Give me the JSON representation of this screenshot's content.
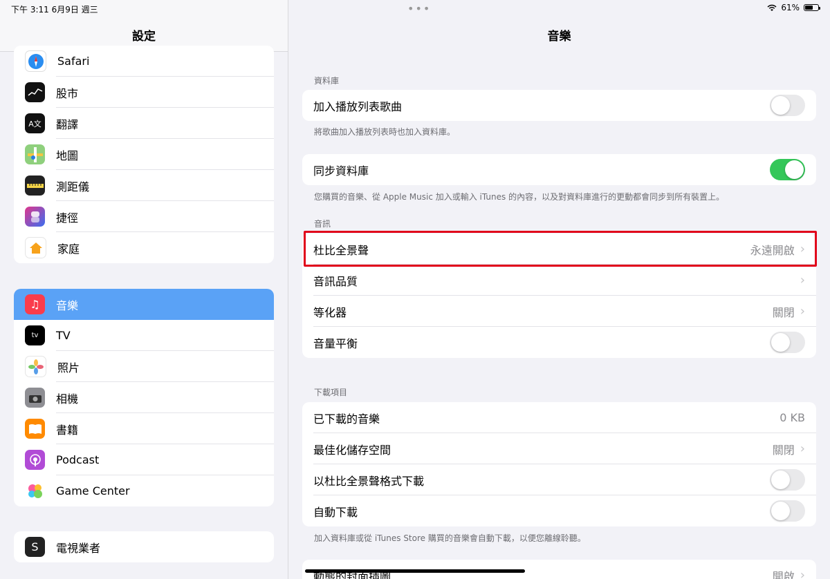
{
  "status": {
    "time_date": "下午 3:11   6月9日 週三",
    "battery": "61%",
    "battery_level": 0.61
  },
  "sidebar": {
    "title": "設定",
    "group1": [
      {
        "label": "Safari",
        "icon": "safari-icon",
        "color": "#1e88e5"
      },
      {
        "label": "股市",
        "icon": "stocks-icon",
        "color": "#111111"
      },
      {
        "label": "翻譯",
        "icon": "translate-icon",
        "color": "#111111"
      },
      {
        "label": "地圖",
        "icon": "maps-icon",
        "color": "#7cc36b"
      },
      {
        "label": "測距儀",
        "icon": "measure-icon",
        "color": "#222222"
      },
      {
        "label": "捷徑",
        "icon": "shortcuts-icon",
        "color": "#6a4cd8"
      },
      {
        "label": "家庭",
        "icon": "home-icon",
        "color": "#ffffff"
      }
    ],
    "group2": [
      {
        "label": "音樂",
        "icon": "music-icon",
        "color": "#fa3c4c"
      },
      {
        "label": "TV",
        "icon": "tv-icon",
        "color": "#000000"
      },
      {
        "label": "照片",
        "icon": "photos-icon",
        "color": "#ffffff"
      },
      {
        "label": "相機",
        "icon": "camera-icon",
        "color": "#8e8e93"
      },
      {
        "label": "書籍",
        "icon": "books-icon",
        "color": "#ff8a00"
      },
      {
        "label": "Podcast",
        "icon": "podcast-icon",
        "color": "#b14bd6"
      },
      {
        "label": "Game Center",
        "icon": "game-center-icon",
        "color": "#ffffff"
      }
    ],
    "group3": [
      {
        "label": "電視業者",
        "icon": "tv-provider-icon",
        "color": "#222222"
      }
    ]
  },
  "main": {
    "title": "音樂",
    "library": {
      "label": "資料庫",
      "add_playlist": "加入播放列表歌曲",
      "add_playlist_on": false,
      "add_playlist_foot": "將歌曲加入播放列表時也加入資料庫。",
      "sync": "同步資料庫",
      "sync_on": true,
      "sync_foot": "您購買的音樂、從 Apple Music 加入或輸入 iTunes 的內容，以及對資料庫進行的更動都會同步到所有裝置上。"
    },
    "audio": {
      "label": "音訊",
      "dolby": "杜比全景聲",
      "dolby_value": "永遠開啟",
      "quality": "音訊品質",
      "eq": "等化器",
      "eq_value": "關閉",
      "volume": "音量平衡",
      "volume_on": false
    },
    "downloads": {
      "label": "下載項目",
      "downloaded": "已下載的音樂",
      "downloaded_value": "0 KB",
      "optimize": "最佳化儲存空間",
      "optimize_value": "關閉",
      "dolby_dl": "以杜比全景聲格式下載",
      "dolby_dl_on": false,
      "auto_dl": "自動下載",
      "auto_dl_on": false,
      "foot": "加入資料庫或從 iTunes Store 購買的音樂會自動下載，以便您離線聆聽。"
    },
    "animated": {
      "label": "動態的封面插圖",
      "value": "開啟"
    }
  },
  "colors": {
    "accent": "#5aa2f6",
    "toggle_on": "#34c759",
    "highlight": "#e1001a"
  }
}
